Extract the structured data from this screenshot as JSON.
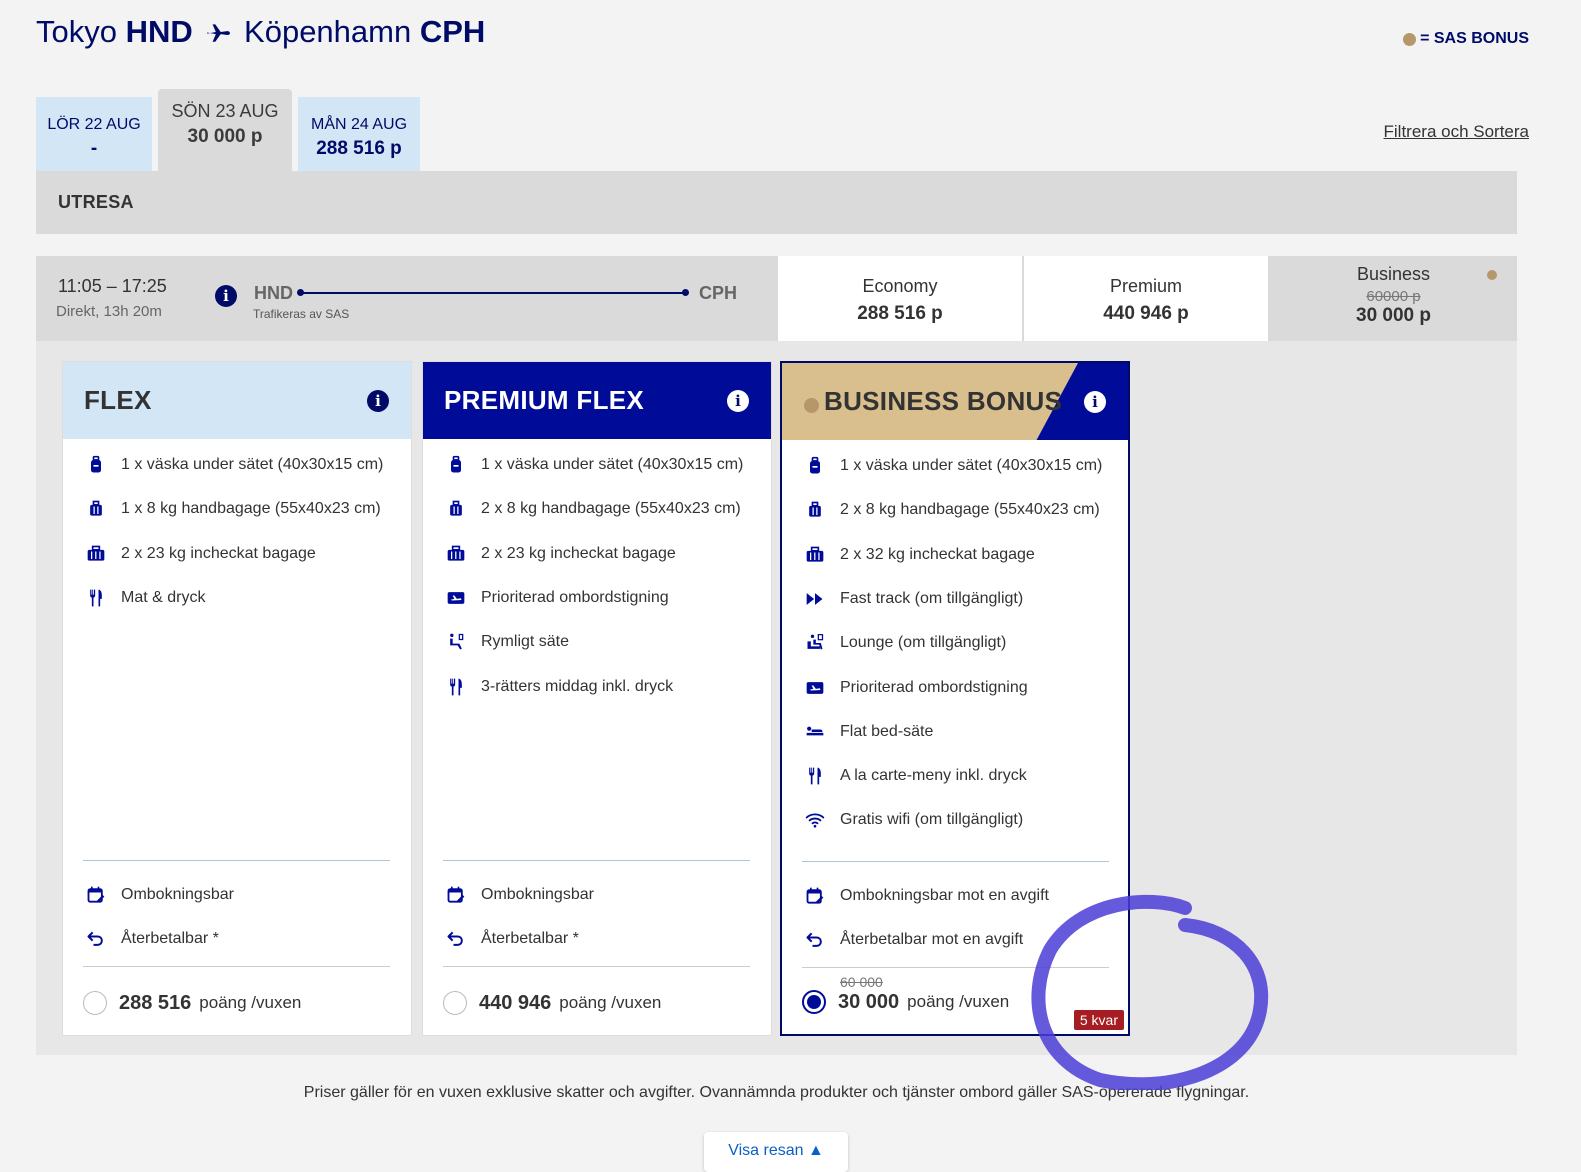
{
  "header": {
    "origin_city": "Tokyo",
    "origin_code": "HND",
    "destination_city": "Köpenhamn",
    "destination_code": "CPH",
    "bonus_legend": "= SAS BONUS"
  },
  "date_tabs": [
    {
      "date": "LÖR 22 AUG",
      "price": "-"
    },
    {
      "date": "SÖN 23 AUG",
      "price": "30 000 p"
    },
    {
      "date": "MÅN 24 AUG",
      "price": "288 516 p"
    }
  ],
  "filter_link": "Filtrera och Sortera",
  "direction_label": "UTRESA",
  "flight": {
    "time": "11:05 – 17:25",
    "duration": "Direkt, 13h 20m",
    "from": "HND",
    "to": "CPH",
    "operated_by": "Trafikeras av SAS"
  },
  "cabins": [
    {
      "name": "Economy",
      "price": "288 516 p"
    },
    {
      "name": "Premium",
      "price": "440 946 p"
    },
    {
      "name": "Business",
      "old_price": "60000 p",
      "price": "30 000 p"
    }
  ],
  "fares": [
    {
      "title": "FLEX",
      "features": [
        {
          "icon": "backpack-icon",
          "text": "1 x väska under sätet (40x30x15 cm)"
        },
        {
          "icon": "suitcase-icon",
          "text": "1 x 8 kg handbagage (55x40x23 cm)"
        },
        {
          "icon": "checked-bag-icon",
          "text": "2 x 23 kg incheckat bagage"
        },
        {
          "icon": "cutlery-icon",
          "text": "Mat & dryck"
        }
      ],
      "conditions": [
        {
          "icon": "calendar-edit-icon",
          "text": "Ombokningsbar"
        },
        {
          "icon": "refund-icon",
          "text": "Återbetalbar *"
        }
      ],
      "points": "288 516",
      "unit": "poäng /vuxen"
    },
    {
      "title": "PREMIUM FLEX",
      "features": [
        {
          "icon": "backpack-icon",
          "text": "1 x väska under sätet (40x30x15 cm)"
        },
        {
          "icon": "suitcase-icon",
          "text": "2 x 8 kg handbagage (55x40x23 cm)"
        },
        {
          "icon": "checked-bag-icon",
          "text": "2 x 23 kg incheckat bagage"
        },
        {
          "icon": "priority-boarding-icon",
          "text": "Prioriterad ombordstigning"
        },
        {
          "icon": "seat-icon",
          "text": "Rymligt säte"
        },
        {
          "icon": "cutlery-icon",
          "text": "3-rätters middag inkl. dryck"
        }
      ],
      "conditions": [
        {
          "icon": "calendar-edit-icon",
          "text": "Ombokningsbar"
        },
        {
          "icon": "refund-icon",
          "text": "Återbetalbar *"
        }
      ],
      "points": "440 946",
      "unit": "poäng /vuxen"
    },
    {
      "title": "BUSINESS BONUS",
      "features": [
        {
          "icon": "backpack-icon",
          "text": "1 x väska under sätet (40x30x15 cm)"
        },
        {
          "icon": "suitcase-icon",
          "text": "2 x 8 kg handbagage (55x40x23 cm)"
        },
        {
          "icon": "checked-bag-icon",
          "text": "2 x 32 kg incheckat bagage"
        },
        {
          "icon": "fast-track-icon",
          "text": "Fast track (om tillgängligt)"
        },
        {
          "icon": "lounge-icon",
          "text": "Lounge (om tillgängligt)"
        },
        {
          "icon": "priority-boarding-icon",
          "text": "Prioriterad ombordstigning"
        },
        {
          "icon": "flat-bed-icon",
          "text": "Flat bed-säte"
        },
        {
          "icon": "cutlery-icon",
          "text": "A la carte-meny inkl. dryck"
        },
        {
          "icon": "wifi-icon",
          "text": "Gratis wifi (om tillgängligt)"
        }
      ],
      "conditions": [
        {
          "icon": "calendar-edit-icon",
          "text": "Ombokningsbar mot en avgift"
        },
        {
          "icon": "refund-icon",
          "text": "Återbetalbar mot en avgift"
        }
      ],
      "old_points": "60 000",
      "points": "30 000",
      "unit": "poäng /vuxen",
      "seats_left": "5 kvar"
    }
  ],
  "footnote": "Priser gäller för en vuxen exklusive skatter och avgifter. Ovannämnda produkter och tjänster ombord gäller SAS-opererade flygningar.",
  "show_trip_button": "Visa resan",
  "colors": {
    "brand_navy": "#000b68",
    "premium_blue": "#000b98",
    "flex_light_blue": "#d2e6f6",
    "bonus_gold": "#b5976a",
    "seats_badge": "#a51d22"
  }
}
